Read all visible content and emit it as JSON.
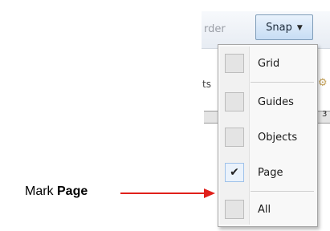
{
  "toolbar": {
    "order_label": "rder",
    "snap_label": "Snap"
  },
  "background": {
    "partial_text": "ts",
    "ruler_number": "3"
  },
  "snap_menu": {
    "items": [
      {
        "label": "Grid",
        "checked": false
      },
      {
        "label": "Guides",
        "checked": false
      },
      {
        "label": "Objects",
        "checked": false
      },
      {
        "label": "Page",
        "checked": true
      },
      {
        "label": "All",
        "checked": false
      }
    ],
    "check_glyph": "✔"
  },
  "annotation": {
    "prefix": "Mark ",
    "bold": "Page"
  },
  "colors": {
    "arrow": "#e0201b",
    "button_border": "#7f9db9"
  }
}
